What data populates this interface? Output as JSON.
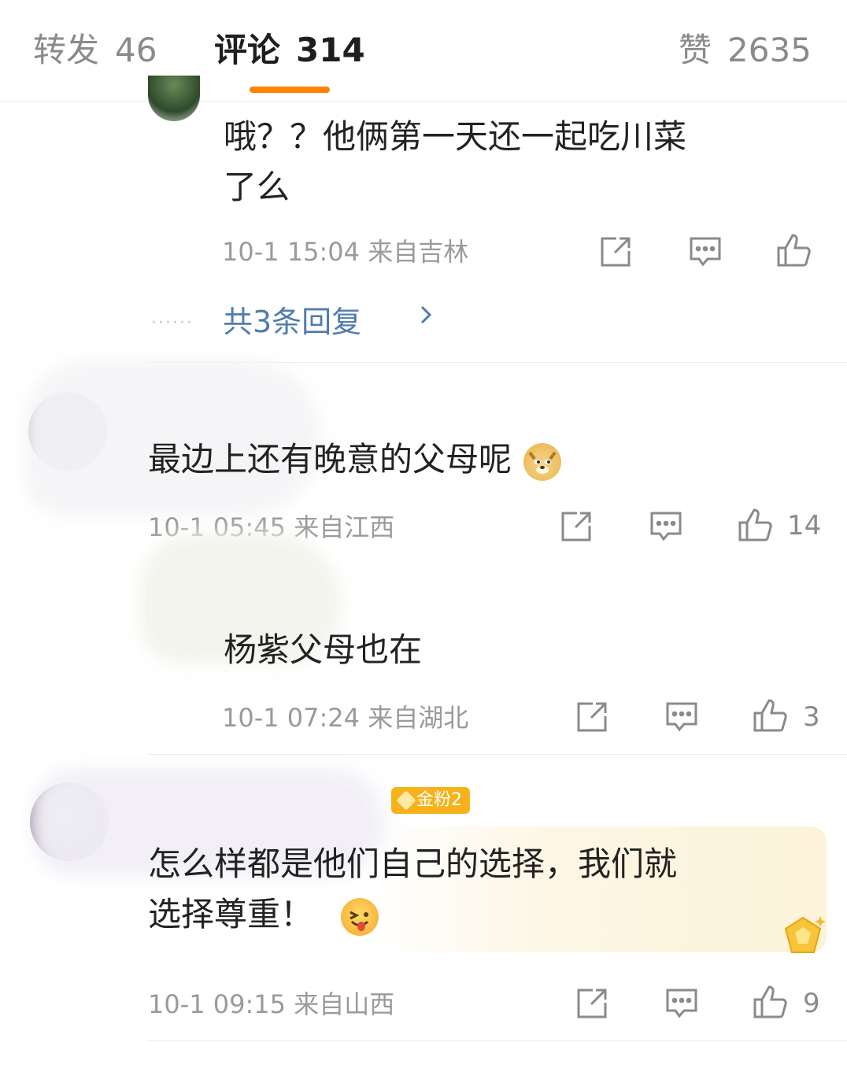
{
  "tabs": {
    "repost": {
      "label": "转发",
      "count": "46"
    },
    "comment": {
      "label": "评论",
      "count": "314"
    },
    "like": {
      "label": "赞",
      "count": "2635"
    }
  },
  "comments": [
    {
      "text_lines": [
        "哦？？他俩第一天还一起吃川菜",
        "了么"
      ],
      "meta": "10-1  15:04  来自吉林",
      "like_count": "",
      "more_replies": "共3条回复"
    },
    {
      "text_lines": [
        "最边上还有晚意的父母呢"
      ],
      "emoji": "doge-emoji",
      "meta": "10-1  05:45  来自江西",
      "like_count": "14"
    },
    {
      "text_lines": [
        "杨紫父母也在"
      ],
      "meta": "10-1  07:24  来自湖北",
      "like_count": "3"
    },
    {
      "badge": "金粉2",
      "text_lines": [
        "怎么样都是他们自己的选择，我们就",
        "选择尊重！"
      ],
      "emoji": "tongue-out-emoji",
      "meta": "10-1  09:15  来自山西",
      "like_count": "9"
    }
  ],
  "colors": {
    "accent": "#ff8200",
    "link": "#507daf",
    "meta": "#9a9a9a",
    "badge": "#f6b21a"
  },
  "icons": [
    "share-icon",
    "comment-icon",
    "like-icon"
  ]
}
